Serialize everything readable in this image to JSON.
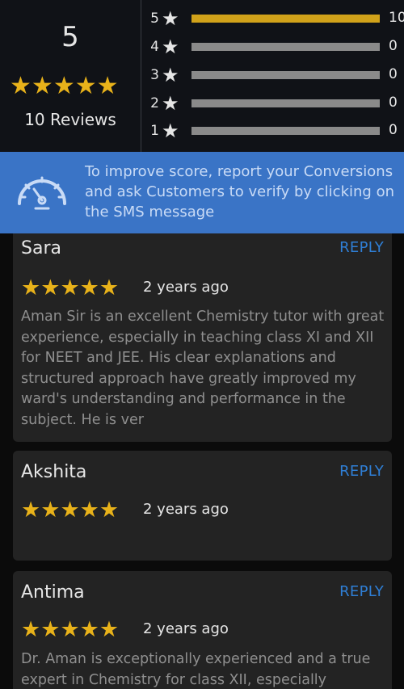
{
  "summary": {
    "average": "5",
    "reviews_label": "10 Reviews",
    "breakdown": [
      {
        "stars": "5",
        "count": "10",
        "fraction": 1.0
      },
      {
        "stars": "4",
        "count": "0",
        "fraction": 0.0
      },
      {
        "stars": "3",
        "count": "0",
        "fraction": 0.0
      },
      {
        "stars": "2",
        "count": "0",
        "fraction": 0.0
      },
      {
        "stars": "1",
        "count": "0",
        "fraction": 0.0
      }
    ]
  },
  "banner": {
    "icon": "speedometer-icon",
    "text": "To improve score, report your Conversions and ask Customers to verify by clicking on the SMS message"
  },
  "reviews": [
    {
      "name": "Sara",
      "reply_label": "REPLY",
      "rating": 5,
      "time": "2 years ago",
      "text": "Aman Sir is an excellent Chemistry tutor with great experience, especially in teaching class XI and XII for NEET and JEE. His clear explanations and structured approach have greatly improved my ward's understanding and performance in the subject. He is ver"
    },
    {
      "name": "Akshita",
      "reply_label": "REPLY",
      "rating": 5,
      "time": "2 years ago",
      "text": ""
    },
    {
      "name": "Antima",
      "reply_label": "REPLY",
      "rating": 5,
      "time": "2 years ago",
      "text": "Dr. Aman is exceptionally experienced and a true expert in Chemistry for class XII, especially"
    }
  ],
  "colors": {
    "star": "#e8b21a",
    "bar_fill": "#d1a21a",
    "bar_track": "#8a8a8a",
    "banner": "#3a74c6",
    "reply": "#2f7fd6"
  }
}
